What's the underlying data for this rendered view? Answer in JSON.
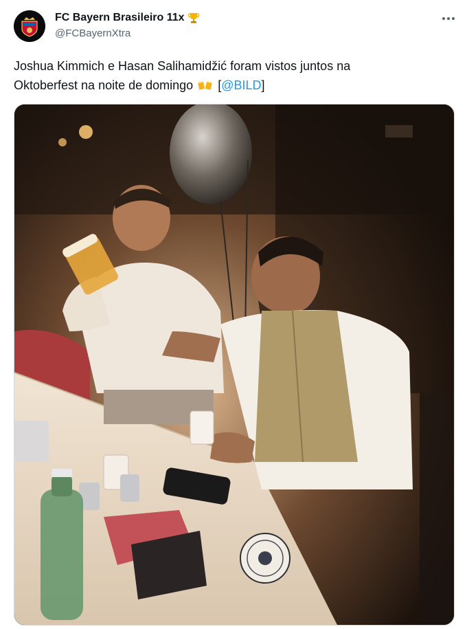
{
  "author": {
    "display_name": "FC Bayern Brasileiro 11x",
    "handle": "@FCBayernXtra",
    "avatar_icon": "club-crest-avatar",
    "badge_icon": "trophy-icon"
  },
  "tweet": {
    "text_line1": "Joshua Kimmich e Hasan Salihamidžić foram vistos juntos na",
    "text_line2_before": "Oktoberfest na noite de domingo",
    "emoji_icon": "beer-mugs-emoji",
    "mention_open": "[",
    "mention": "@BILD",
    "mention_close": "]"
  },
  "media": {
    "kind": "photo",
    "scene_icon": "oktoberfest-photo"
  },
  "colors": {
    "text": "#0f1419",
    "secondary": "#536471",
    "link": "#1d9bf0"
  }
}
